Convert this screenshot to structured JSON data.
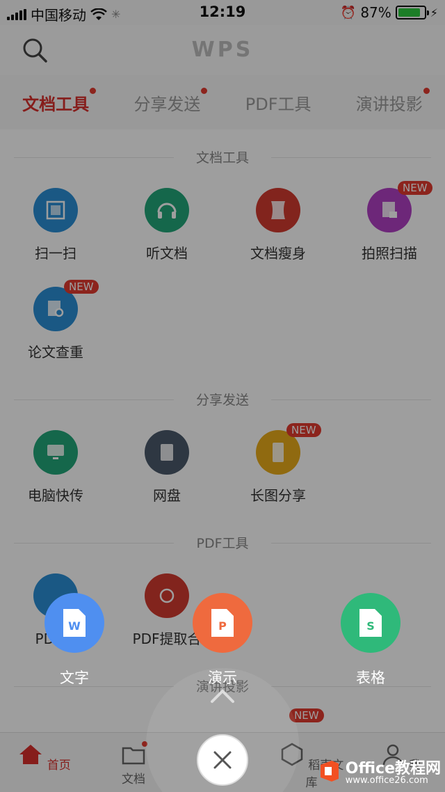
{
  "status_bar": {
    "carrier": "中国移动",
    "time": "12:19",
    "battery_text": "87%",
    "battery_level": 0.87
  },
  "header": {
    "logo": "WPS"
  },
  "tabs": [
    {
      "label": "文档工具",
      "active": true,
      "dot": true
    },
    {
      "label": "分享发送",
      "active": false,
      "dot": true
    },
    {
      "label": "PDF工具",
      "active": false,
      "dot": false
    },
    {
      "label": "演讲投影",
      "active": false,
      "dot": true
    }
  ],
  "sections": {
    "doc_tools": {
      "title": "文档工具",
      "items": [
        {
          "label": "扫一扫",
          "color": "#2b8fd6",
          "icon": "scan-icon"
        },
        {
          "label": "听文档",
          "color": "#23a67a",
          "icon": "headphones-icon"
        },
        {
          "label": "文档瘦身",
          "color": "#d23a2f",
          "icon": "slim-doc-icon"
        },
        {
          "label": "拍照扫描",
          "color": "#b03fc4",
          "icon": "photo-scan-icon",
          "badge": "NEW"
        },
        {
          "label": "论文查重",
          "color": "#2b8fd6",
          "icon": "thesis-check-icon",
          "badge": "NEW"
        }
      ]
    },
    "share": {
      "title": "分享发送",
      "items": [
        {
          "label": "电脑快传",
          "color": "#23a67a",
          "icon": "pc-transfer-icon"
        },
        {
          "label": "网盘",
          "color": "#4b5a6b",
          "icon": "cloud-disk-icon"
        },
        {
          "label": "长图分享",
          "color": "#e9ab1a",
          "icon": "long-image-icon",
          "badge": "NEW"
        }
      ]
    },
    "pdf": {
      "title": "PDF工具",
      "items": [
        {
          "label": "PDF转",
          "color": "#2b8fd6",
          "icon": "pdf-convert-icon"
        },
        {
          "label": "PDF提取合",
          "color": "#d23a2f",
          "icon": "pdf-extract-icon"
        }
      ],
      "partial_badge": "NEW",
      "partial_label": "演讲投影"
    }
  },
  "create_menu": [
    {
      "label": "文字",
      "color": "#4f8ff0",
      "icon": "writer-icon",
      "letter": "W"
    },
    {
      "label": "演示",
      "color": "#ef6a3e",
      "icon": "presentation-icon",
      "letter": "P"
    },
    {
      "label": "表格",
      "color": "#2fb97a",
      "icon": "spreadsheet-icon",
      "letter": "S"
    }
  ],
  "bottom_nav": [
    {
      "label": "首页",
      "icon": "home-icon",
      "active": true
    },
    {
      "label": "文档",
      "icon": "folder-icon",
      "active": false,
      "dot": true
    },
    {
      "label": "稻壳文库",
      "icon": "docer-icon",
      "active": false
    },
    {
      "label": "我",
      "icon": "profile-icon",
      "active": false
    }
  ],
  "watermark": {
    "text": "Office教程网",
    "url": "www.office26.com"
  }
}
